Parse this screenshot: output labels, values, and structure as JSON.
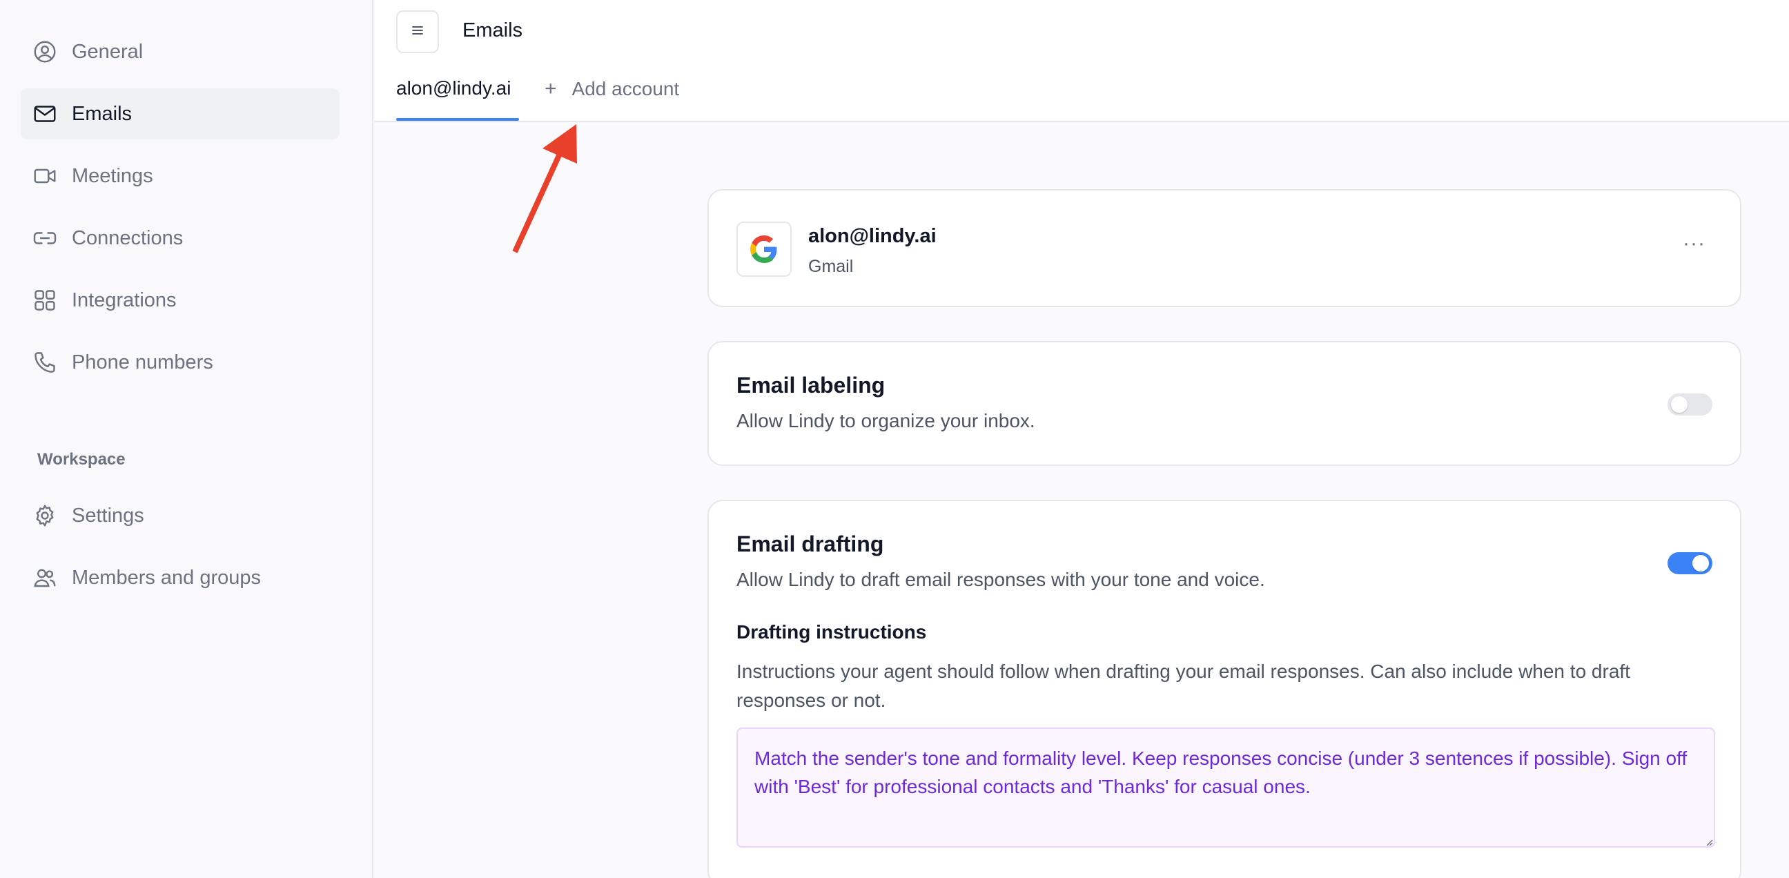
{
  "sidebar": {
    "items": [
      {
        "label": "General",
        "icon": "user-circle-icon",
        "active": false
      },
      {
        "label": "Emails",
        "icon": "mail-icon",
        "active": true
      },
      {
        "label": "Meetings",
        "icon": "video-icon",
        "active": false
      },
      {
        "label": "Connections",
        "icon": "link-icon",
        "active": false
      },
      {
        "label": "Integrations",
        "icon": "grid-icon",
        "active": false
      },
      {
        "label": "Phone numbers",
        "icon": "phone-icon",
        "active": false
      }
    ],
    "section_label": "Workspace",
    "workspace_items": [
      {
        "label": "Settings",
        "icon": "gear-icon"
      },
      {
        "label": "Members and groups",
        "icon": "users-icon"
      }
    ]
  },
  "header": {
    "title": "Emails",
    "tabs": {
      "account": "alon@lindy.ai",
      "add": "Add account"
    }
  },
  "account_card": {
    "email": "alon@lindy.ai",
    "provider": "Gmail",
    "more": "···"
  },
  "labeling_card": {
    "title": "Email labeling",
    "description": "Allow Lindy to organize your inbox.",
    "enabled": false
  },
  "drafting_card": {
    "title": "Email drafting",
    "description": "Allow Lindy to draft email responses with your tone and voice.",
    "enabled": true,
    "instructions_title": "Drafting instructions",
    "instructions_desc": "Instructions your agent should follow when drafting your email responses. Can also include when to draft responses or not.",
    "instructions_value": "Match the sender's tone and formality level. Keep responses concise (under 3 sentences if possible). Sign off with 'Best' for professional contacts and 'Thanks' for casual ones."
  },
  "colors": {
    "accent": "#3b82f6",
    "annotation_arrow": "#e8402a",
    "instructions_text": "#6d28d9"
  }
}
